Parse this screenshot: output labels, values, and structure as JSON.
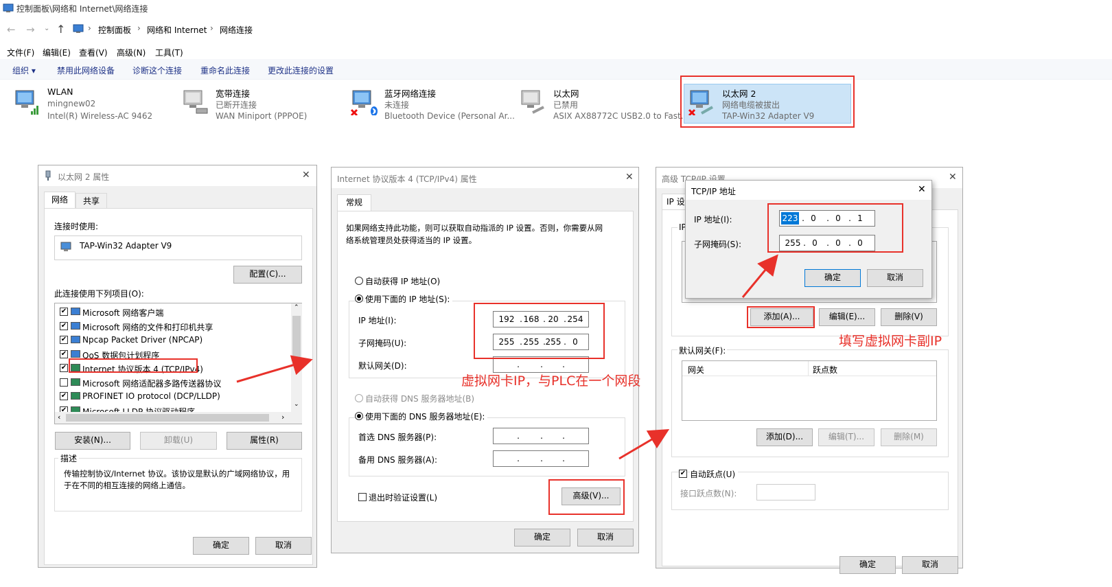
{
  "window": {
    "title": "控制面板\\网络和 Internet\\网络连接"
  },
  "nav": {
    "crumbs": [
      "控制面板",
      "网络和 Internet",
      "网络连接"
    ],
    "sep": "›"
  },
  "menu": [
    "文件(F)",
    "编辑(E)",
    "查看(V)",
    "高级(N)",
    "工具(T)"
  ],
  "toolbar": {
    "organize": "组织 ▾",
    "items": [
      "禁用此网络设备",
      "诊断这个连接",
      "重命名此连接",
      "更改此连接的设置"
    ]
  },
  "connections": [
    {
      "name": "WLAN",
      "status": "mingnew02",
      "adapter": "Intel(R) Wireless-AC 9462",
      "icon": "wifi-adapter-icon"
    },
    {
      "name": "宽带连接",
      "status": "已断开连接",
      "adapter": "WAN Miniport (PPPOE)",
      "icon": "broadband-adapter-icon"
    },
    {
      "name": "蓝牙网络连接",
      "status": "未连接",
      "adapter": "Bluetooth Device (Personal Ar...",
      "icon": "bluetooth-adapter-icon"
    },
    {
      "name": "以太网",
      "status": "已禁用",
      "adapter": "ASIX AX88772C USB2.0 to Fast...",
      "icon": "ethernet-adapter-icon"
    },
    {
      "name": "以太网 2",
      "status": "网络电缆被拔出",
      "adapter": "TAP-Win32 Adapter V9",
      "icon": "tap-adapter-icon"
    }
  ],
  "props": {
    "title": "以太网 2 属性",
    "tabs": [
      "网络",
      "共享"
    ],
    "connect_using_label": "连接时使用:",
    "adapter": "TAP-Win32 Adapter V9",
    "configure": "配置(C)...",
    "items_label": "此连接使用下列项目(O):",
    "items": [
      {
        "checked": "✔",
        "label": "Microsoft 网络客户端"
      },
      {
        "checked": "✔",
        "label": "Microsoft 网络的文件和打印机共享"
      },
      {
        "checked": "✔",
        "label": "Npcap Packet Driver (NPCAP)"
      },
      {
        "checked": "✔",
        "label": "QoS 数据包计划程序"
      },
      {
        "checked": "✔",
        "label": "Internet 协议版本 4 (TCP/IPv4)"
      },
      {
        "checked": "",
        "label": "Microsoft 网络适配器多路传送器协议"
      },
      {
        "checked": "✔",
        "label": "PROFINET IO protocol (DCP/LLDP)"
      },
      {
        "checked": "✔",
        "label": "Microsoft LLDP 协议驱动程序"
      }
    ],
    "install": "安装(N)...",
    "uninstall": "卸载(U)",
    "properties": "属性(R)",
    "desc_label": "描述",
    "desc": [
      "传输控制协议/Internet 协议。该协议是默认的广域网络协议，用",
      "于在不同的相互连接的网络上通信。"
    ],
    "ok": "确定",
    "cancel": "取消"
  },
  "ipv4": {
    "title": "Internet 协议版本 4 (TCP/IPv4) 属性",
    "tab": "常规",
    "intro": [
      "如果网络支持此功能，则可以获取自动指派的 IP 设置。否则，你需要从网",
      "络系统管理员处获得适当的 IP 设置。"
    ],
    "auto_ip": "自动获得 IP 地址(O)",
    "use_ip": "使用下面的 IP 地址(S):",
    "ip_label": "IP 地址(I):",
    "ip": [
      "192",
      "168",
      "20",
      "254"
    ],
    "mask_label": "子网掩码(U):",
    "mask": [
      "255",
      "255",
      "255",
      "0"
    ],
    "gw_label": "默认网关(D):",
    "auto_dns": "自动获得 DNS 服务器地址(B)",
    "use_dns": "使用下面的 DNS 服务器地址(E):",
    "dns1_label": "首选 DNS 服务器(P):",
    "dns2_label": "备用 DNS 服务器(A):",
    "validate": "退出时验证设置(L)",
    "advanced": "高级(V)...",
    "ok": "确定",
    "cancel": "取消"
  },
  "advanced": {
    "title": "高级 TCP/IP 设置",
    "tab": "IP 设",
    "group_ip": "IP",
    "add": "添加(A)...",
    "edit": "编辑(E)...",
    "remove": "删除(V)",
    "gateway_label": "默认网关(F):",
    "col_gateway": "网关",
    "col_metric": "跃点数",
    "gw_add": "添加(D)...",
    "gw_edit": "编辑(T)...",
    "gw_remove": "删除(M)",
    "auto_metric": "自动跃点(U)",
    "iface_metric": "接口跃点数(N):",
    "ok": "确定",
    "cancel": "取消"
  },
  "tcpip_popup": {
    "title": "TCP/IP 地址",
    "ip_label": "IP 地址(I):",
    "ip": [
      "223",
      "0",
      "0",
      "1"
    ],
    "mask_label": "子网掩码(S):",
    "mask": [
      "255",
      "0",
      "0",
      "0"
    ],
    "ok": "确定",
    "cancel": "取消"
  },
  "annotations": {
    "ip_note": "虚拟网卡IP，与PLC在一个网段",
    "sub_ip_note": "填写虚拟网卡副IP",
    "color": "#e8312a"
  }
}
